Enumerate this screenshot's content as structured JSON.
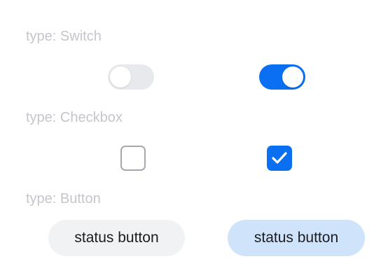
{
  "sections": {
    "switch": {
      "label": "type: Switch",
      "off_state": "off",
      "on_state": "on"
    },
    "checkbox": {
      "label": "type: Checkbox",
      "unchecked_state": "unchecked",
      "checked_state": "checked"
    },
    "button": {
      "label": "type: Button",
      "off_text": "status button",
      "on_text": "status button"
    }
  },
  "colors": {
    "accent": "#0a6ff0",
    "switch_off": "#e8e9ec",
    "button_off_bg": "#f1f2f4",
    "button_on_bg": "#cfe3fb",
    "label_text": "#c4c6cc"
  },
  "icons": {
    "checkmark": "check-icon"
  }
}
